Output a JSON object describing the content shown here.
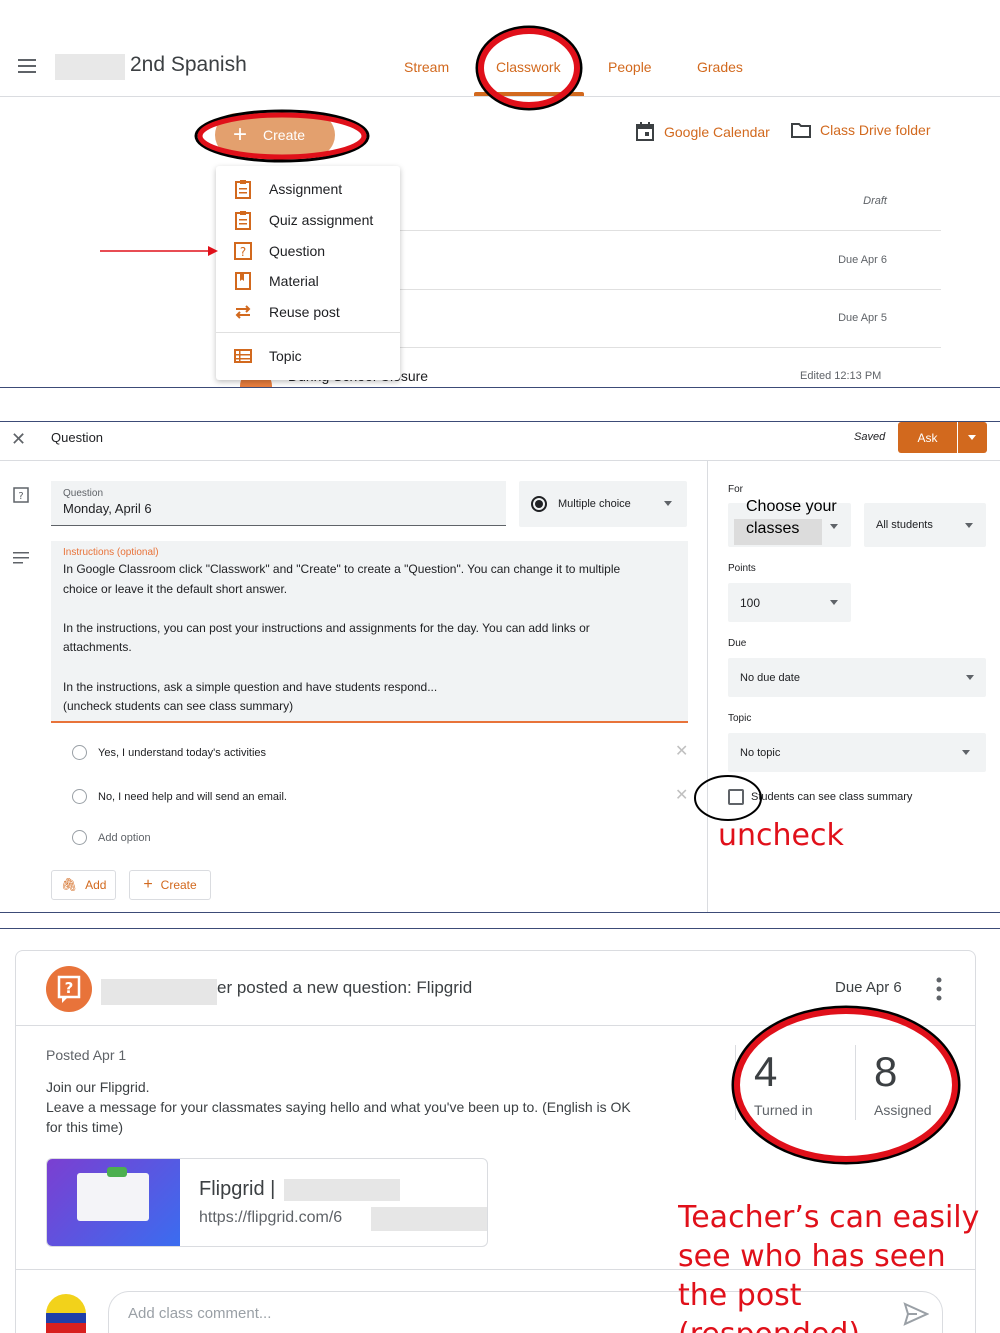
{
  "panel1": {
    "class_name": "2nd Spanish",
    "tabs": [
      "Stream",
      "Classwork",
      "People",
      "Grades"
    ],
    "create_label": "Create",
    "google_calendar": "Google Calendar",
    "drive_folder": "Class Drive folder",
    "menu_items": [
      "Assignment",
      "Quiz assignment",
      "Question",
      "Material",
      "Reuse post",
      "Topic"
    ],
    "rows": [
      {
        "meta": "Draft"
      },
      {
        "meta": "Due Apr 6"
      },
      {
        "meta": "Due Apr 5"
      },
      {
        "title": "During School Closure",
        "meta": "Edited 12:13 PM"
      }
    ]
  },
  "panel2": {
    "header_title": "Question",
    "saved": "Saved",
    "ask": "Ask",
    "question_label": "Question",
    "question_value": "Monday, April 6",
    "type_select": "Multiple choice",
    "instructions_label": "Instructions (optional)",
    "instructions": [
      "In Google Classroom click \"Classwork\" and \"Create\" to create a \"Question\". You can change it to multiple",
      "choice or leave it the default short answer.",
      "",
      "In the instructions, you can post your instructions and assignments for the day. You can add links or",
      "attachments.",
      "",
      "In the instructions, ask a simple question and have students respond...",
      "(uncheck students can see class summary)"
    ],
    "options": [
      "Yes, I understand today's activities",
      "No, I need help and will send an email."
    ],
    "add_option": "Add option",
    "add_btn": "Add",
    "create_btn": "Create",
    "for_label": "For",
    "choose_classes": "Choose your classes",
    "all_students": "All students",
    "points_label": "Points",
    "points_value": "100",
    "due_label": "Due",
    "due_value": "No due date",
    "topic_label": "Topic",
    "topic_value": "No topic",
    "checkbox_label": "Students can see class summary",
    "annotation": "uncheck"
  },
  "panel3": {
    "post_title": "er posted a new question: Flipgrid",
    "due": "Due Apr 6",
    "posted": "Posted Apr 1",
    "body_line1": "Join our Flipgrid.",
    "body_line2": "Leave a message for your classmates saying hello and what you've been up to. (English is OK",
    "body_line3": "for this time)",
    "turned_in_count": "4",
    "turned_in_label": "Turned in",
    "assigned_count": "8",
    "assigned_label": "Assigned",
    "link_title": "Flipgrid |",
    "link_url": "https://flipgrid.com/6",
    "comment_placeholder": "Add class comment...",
    "annotation_lines": [
      "Teacher’s can easily",
      "see who has seen",
      "the post",
      "(responded)"
    ]
  },
  "colors": {
    "accent": "#d2691e",
    "annotation_red": "#e0101a",
    "divider_blue": "#3c4b77"
  }
}
